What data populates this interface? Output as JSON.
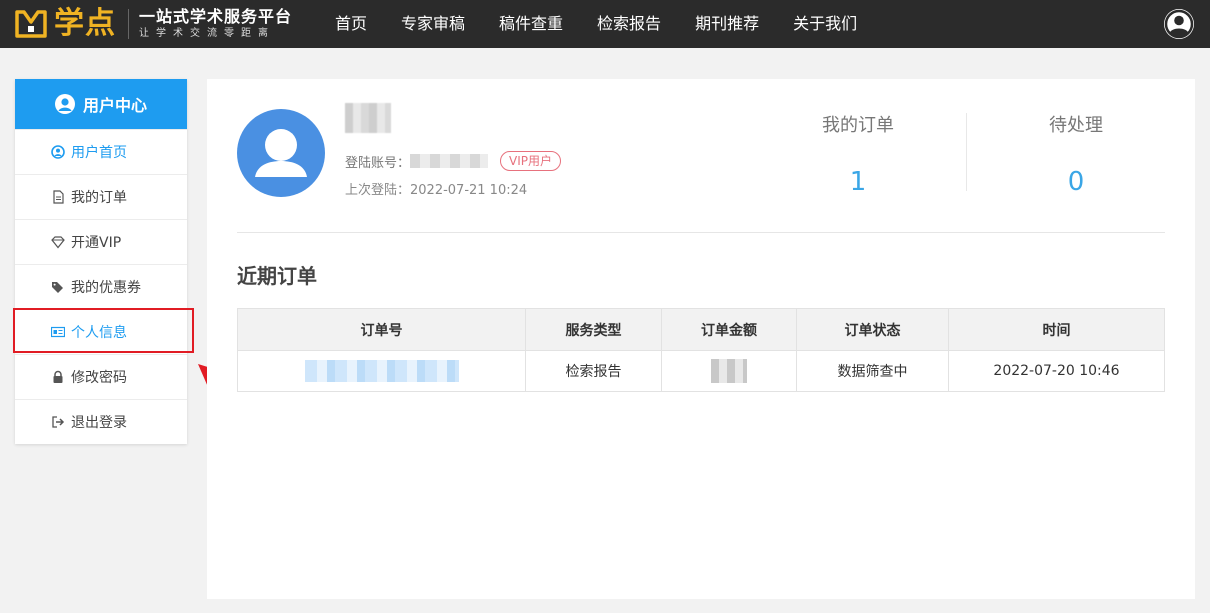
{
  "header": {
    "logo_name": "学点",
    "slogan": "一站式学术服务平台",
    "slogan_sub": "让学术交流零距离",
    "nav": [
      "首页",
      "专家审稿",
      "稿件查重",
      "检索报告",
      "期刊推荐",
      "关于我们"
    ]
  },
  "sidebar": {
    "title": "用户中心",
    "items": [
      {
        "label": "用户首页",
        "icon": "user-circle-icon"
      },
      {
        "label": "我的订单",
        "icon": "document-icon"
      },
      {
        "label": "开通VIP",
        "icon": "diamond-icon"
      },
      {
        "label": "我的优惠券",
        "icon": "tags-icon"
      },
      {
        "label": "个人信息",
        "icon": "id-card-icon"
      },
      {
        "label": "修改密码",
        "icon": "lock-icon"
      },
      {
        "label": "退出登录",
        "icon": "logout-icon"
      }
    ]
  },
  "profile": {
    "account_label": "登陆账号：",
    "vip_badge": "VIP用户",
    "last_login": "上次登陆：2022-07-21 10:24"
  },
  "stats": [
    {
      "label": "我的订单",
      "value": "1"
    },
    {
      "label": "待处理",
      "value": "0"
    }
  ],
  "recent": {
    "title": "近期订单",
    "columns": [
      "订单号",
      "服务类型",
      "订单金额",
      "订单状态",
      "时间"
    ],
    "rows": [
      {
        "service": "检索报告",
        "status": "数据筛查中",
        "time": "2022-07-20 10:46"
      }
    ]
  },
  "colors": {
    "accent": "#1e9cf0",
    "logo": "#f0b323",
    "highlight": "#e11c24",
    "status": "#8a2be2"
  }
}
